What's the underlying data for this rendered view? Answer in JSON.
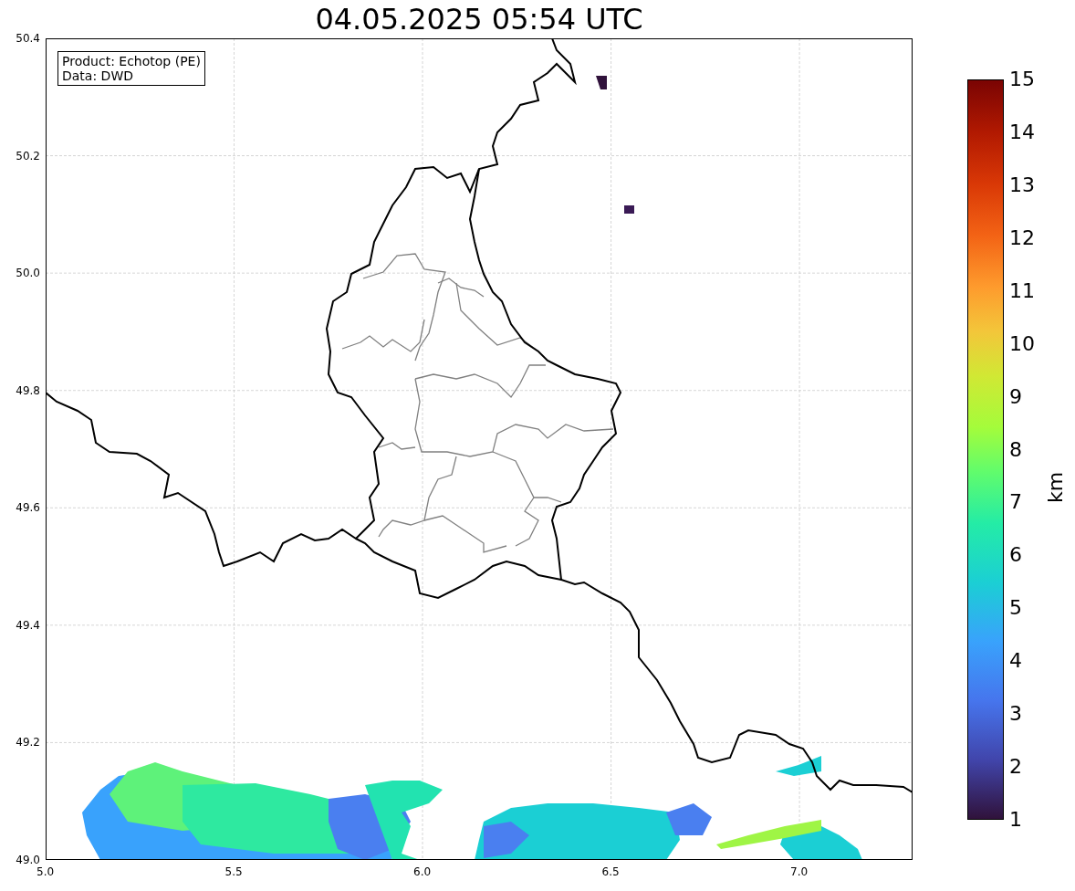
{
  "title": "04.05.2025 05:54 UTC",
  "legend": [
    "Product: Echotop (PE)",
    "Data: DWD"
  ],
  "x_ticks": [
    "5.0",
    "5.5",
    "6.0",
    "6.5",
    "7.0"
  ],
  "y_ticks": [
    "50.4",
    "50.2",
    "50.0",
    "49.8",
    "49.6",
    "49.4",
    "49.2",
    "49.0"
  ],
  "colorbar": {
    "label": "km",
    "ticks": [
      "15",
      "14",
      "13",
      "12",
      "11",
      "10",
      "9",
      "8",
      "7",
      "6",
      "5",
      "4",
      "3",
      "2",
      "1"
    ]
  }
}
